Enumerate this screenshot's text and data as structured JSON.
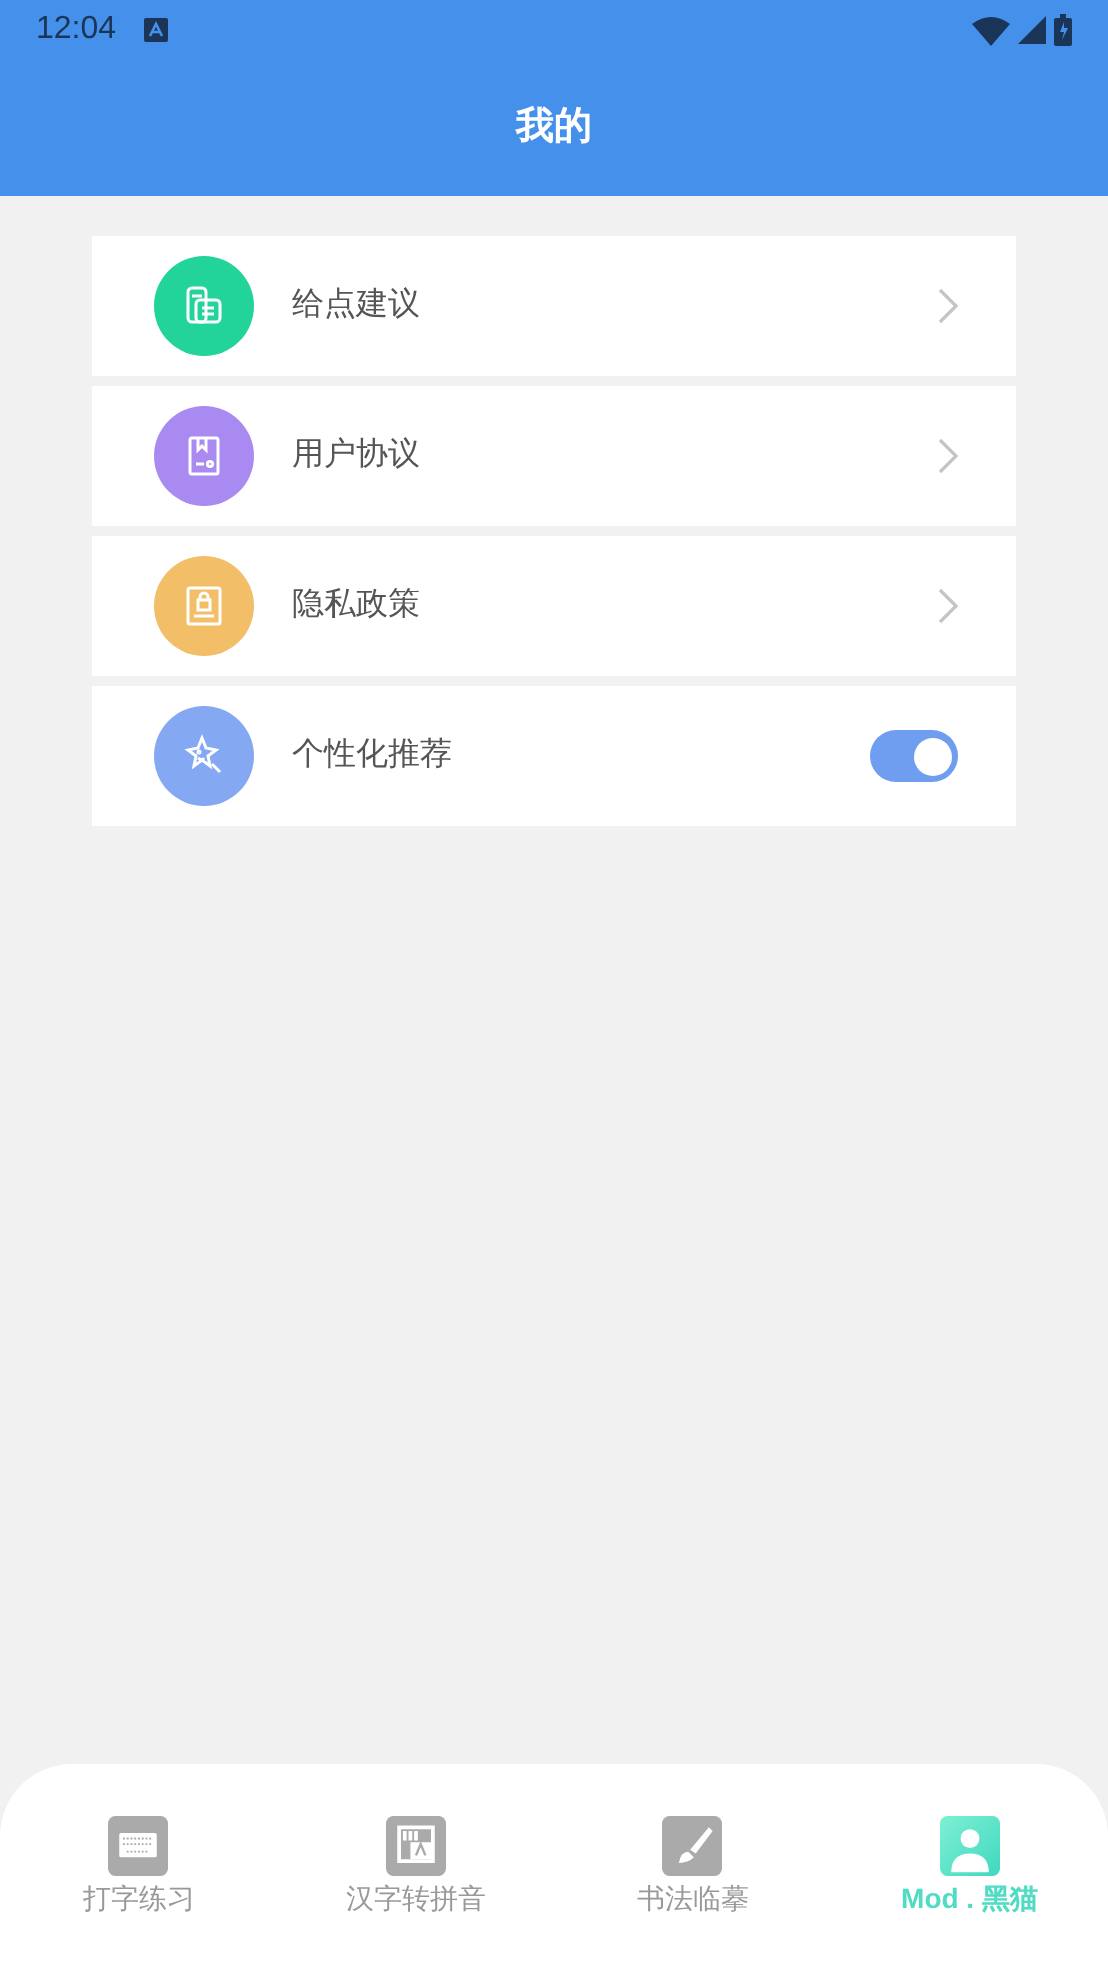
{
  "status_bar": {
    "time": "12:04"
  },
  "header": {
    "title": "我的"
  },
  "items": [
    {
      "kind": "link",
      "label": "给点建议",
      "color": "#22d39a"
    },
    {
      "kind": "link",
      "label": "用户协议",
      "color": "#a98af0"
    },
    {
      "kind": "link",
      "label": "隐私政策",
      "color": "#f2be68"
    },
    {
      "kind": "toggle",
      "label": "个性化推荐",
      "color": "#84a8f2",
      "on": true
    }
  ],
  "tabs": [
    {
      "label": "打字练习",
      "selected": false
    },
    {
      "label": "汉字转拼音",
      "selected": false
    },
    {
      "label": "书法临摹",
      "selected": false
    },
    {
      "label": "Mod . 黑猫",
      "selected": true
    }
  ]
}
